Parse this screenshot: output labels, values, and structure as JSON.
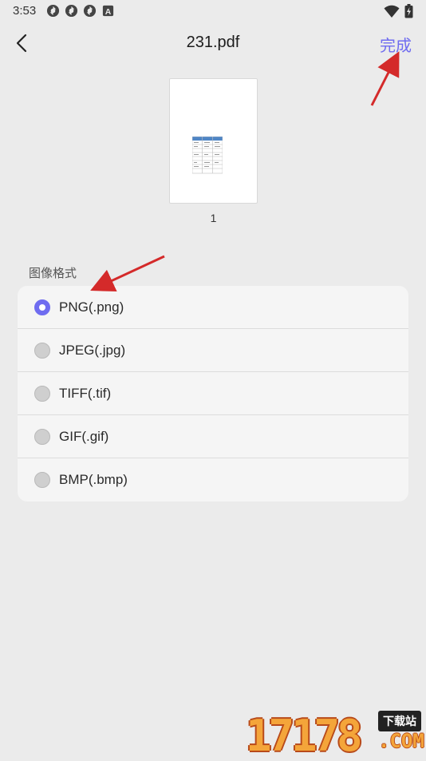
{
  "status_bar": {
    "time": "3:53",
    "left_icons": [
      "sync-icon",
      "sync-icon",
      "sync-icon",
      "a-badge-icon"
    ],
    "right_icons": [
      "wifi-icon",
      "battery-icon"
    ]
  },
  "header": {
    "title": "231.pdf",
    "done_label": "完成",
    "back_icon": "chevron-left-icon"
  },
  "preview": {
    "page_number": "1"
  },
  "image_format": {
    "section_label": "图像格式",
    "options": [
      {
        "label": "PNG(.png)",
        "selected": true
      },
      {
        "label": "JPEG(.jpg)",
        "selected": false
      },
      {
        "label": "TIFF(.tif)",
        "selected": false
      },
      {
        "label": "GIF(.gif)",
        "selected": false
      },
      {
        "label": "BMP(.bmp)",
        "selected": false
      }
    ]
  },
  "colors": {
    "accent": "#6f6cf0",
    "annotation_arrow": "#d42a2a",
    "background": "#ebebeb",
    "card": "#f5f5f5"
  },
  "watermark": {
    "digits": "17178",
    "badge": "下载站",
    "suffix": ".COM"
  }
}
